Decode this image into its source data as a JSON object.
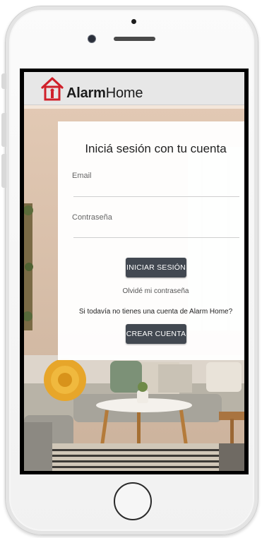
{
  "brand": {
    "name_bold": "Alarm",
    "name_light": "Home",
    "accent_color": "#d0202a",
    "logo_icon": "house-logo-icon"
  },
  "login": {
    "title": "Iniciá sesión con tu cuenta",
    "email_label": "Email",
    "email_value": "",
    "password_label": "Contraseña",
    "password_value": "",
    "submit_label": "INICIAR SESIÓN",
    "forgot_label": "Olvidé mi contraseña",
    "signup_prompt": "Si todavía no tienes una cuenta de Alarm Home?",
    "signup_label": "CREAR CUENTA"
  },
  "colors": {
    "button_bg": "#424851",
    "header_bg": "#e7e7e7"
  }
}
